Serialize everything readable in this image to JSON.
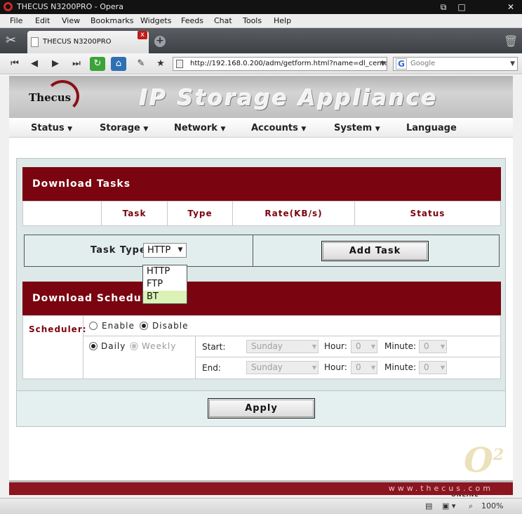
{
  "window": {
    "title": "THECUS N3200PRO - Opera"
  },
  "menu": [
    "File",
    "Edit",
    "View",
    "Bookmarks",
    "Widgets",
    "Feeds",
    "Chat",
    "Tools",
    "Help"
  ],
  "tab": {
    "title": "THECUS N3200PRO",
    "close": "x",
    "new": "+"
  },
  "address": {
    "url": "http://192.168.0.200/adm/getform.html?name=dl_cente",
    "search_placeholder": "Google",
    "search_logo": "G"
  },
  "page": {
    "logo": "Thecus",
    "banner_title": "IP Storage Appliance",
    "nav": [
      {
        "label": "Status",
        "has_menu": true
      },
      {
        "label": "Storage",
        "has_menu": true
      },
      {
        "label": "Network",
        "has_menu": true
      },
      {
        "label": "Accounts",
        "has_menu": true
      },
      {
        "label": "System",
        "has_menu": true
      },
      {
        "label": "Language",
        "has_menu": false
      }
    ],
    "download_tasks": {
      "title": "Download Tasks",
      "columns": [
        "Task",
        "Type",
        "Rate(KB/s)",
        "Status"
      ]
    },
    "task_type": {
      "label": "Task Type",
      "selected": "HTTP",
      "options": [
        "HTTP",
        "FTP",
        "BT"
      ],
      "highlighted": "BT",
      "add_button": "Add Task"
    },
    "schedule": {
      "title": "Download Schedule",
      "scheduler_label": "Scheduler:",
      "enable": "Enable",
      "disable": "Disable",
      "selected_mode": "Disable",
      "daily": "Daily",
      "weekly": "Weekly",
      "selected_period": "Daily",
      "start": {
        "label": "Start:",
        "day": "Sunday",
        "hour_label": "Hour:",
        "hour": "0",
        "minute_label": "Minute:",
        "minute": "0"
      },
      "end": {
        "label": "End:",
        "day": "Sunday",
        "hour_label": "Hour:",
        "hour": "0",
        "minute_label": "Minute:",
        "minute": "0"
      }
    },
    "apply": "Apply",
    "footer_url": "www.thecus.com"
  },
  "watermark": {
    "letter": "O",
    "superscript": "2",
    "text": "OVERCLOCKERS ONLINE"
  },
  "statusbar": {
    "zoom": "100%"
  },
  "colors": {
    "brand_red": "#7a0410",
    "highlight": "#dbf1b6"
  }
}
